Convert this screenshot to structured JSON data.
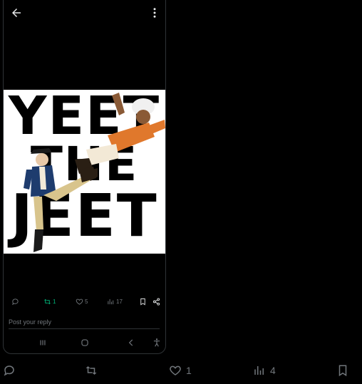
{
  "post": {
    "meme_text": [
      "YEET",
      "THE",
      "JEET"
    ],
    "retweets": "1",
    "likes": "5",
    "views": "17"
  },
  "composer": {
    "placeholder": "Post your reply"
  },
  "outer_actions": {
    "likes": "1",
    "views": "4"
  },
  "colors": {
    "background": "#000000",
    "muted": "#71767b",
    "green": "#00ba7c",
    "text": "#e7e9ea"
  },
  "icons": [
    "back-arrow-icon",
    "more-vertical-icon",
    "reply-icon",
    "retweet-icon",
    "heart-icon",
    "views-icon",
    "bookmark-icon",
    "share-icon",
    "recents-icon",
    "home-icon",
    "back-nav-icon",
    "accessibility-icon"
  ]
}
